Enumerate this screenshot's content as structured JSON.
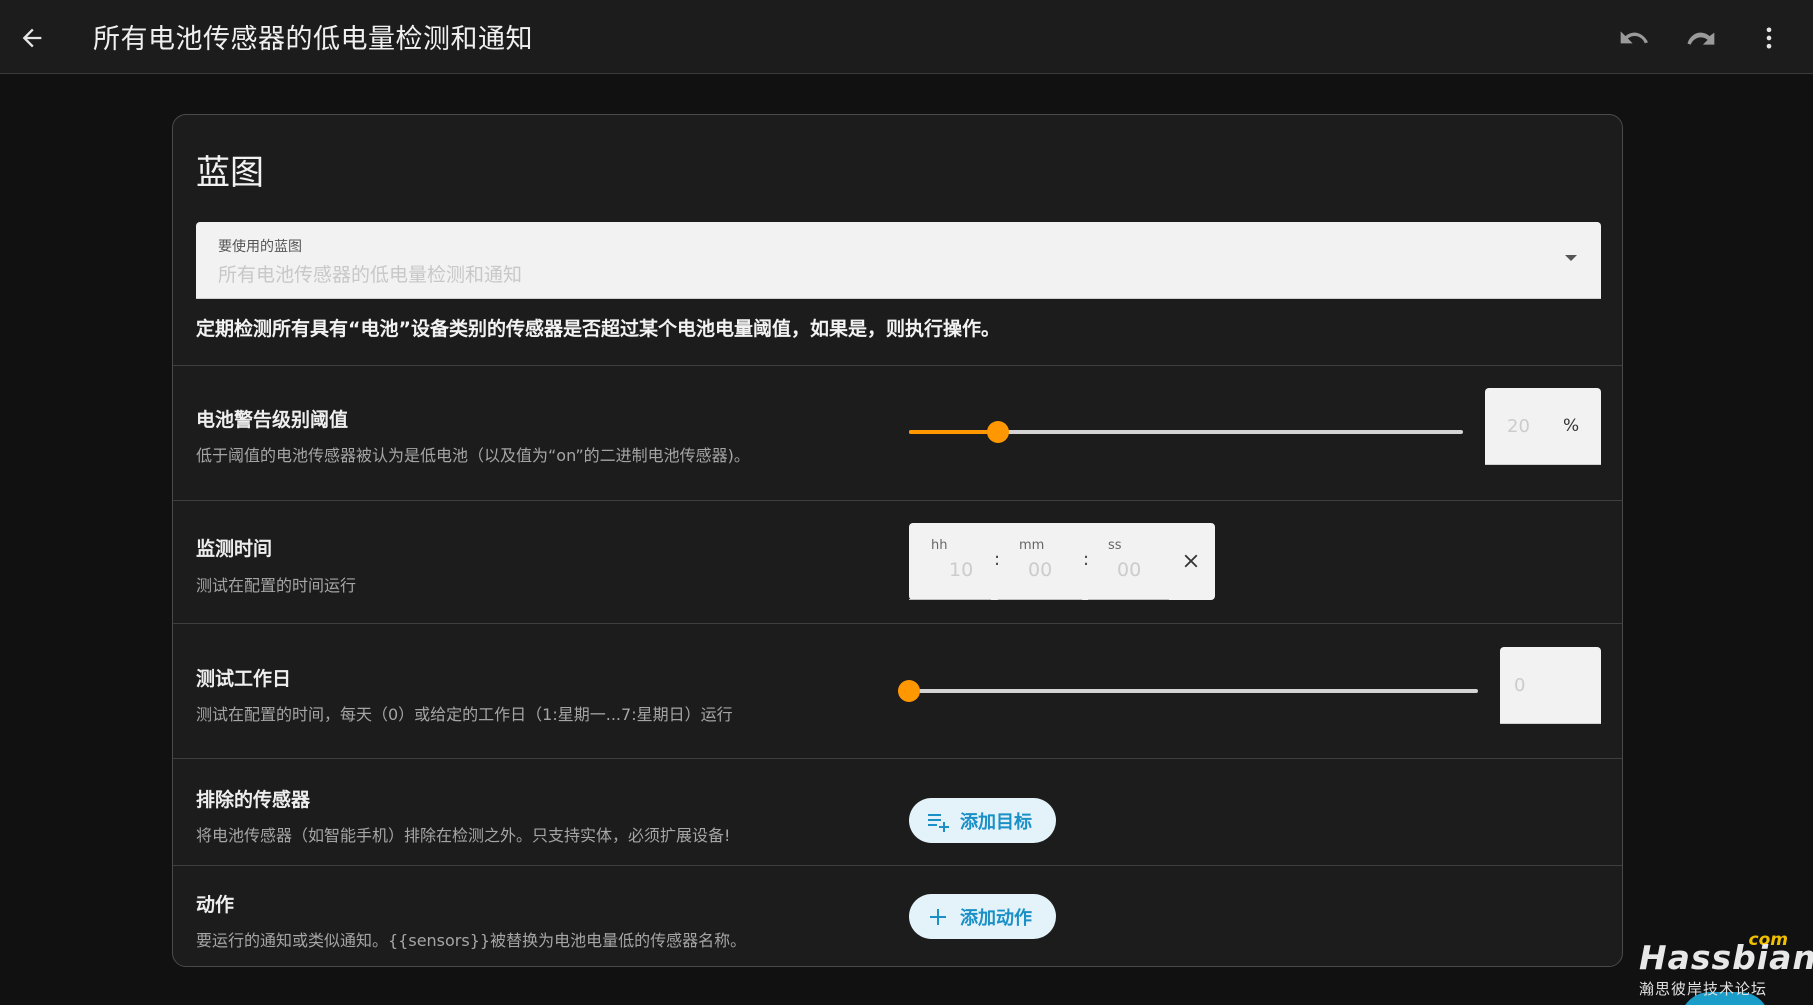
{
  "topbar": {
    "title": "所有电池传感器的低电量检测和通知",
    "icons": [
      "arrow-left-icon",
      "undo-icon",
      "redo-icon",
      "more-vertical-icon"
    ]
  },
  "card": {
    "title": "蓝图",
    "blueprint_select": {
      "label": "要使用的蓝图",
      "value": "所有电池传感器的低电量检测和通知"
    },
    "description": "定期检测所有具有“电池”设备类别的传感器是否超过某个电池电量阈值，如果是，则执行操作。"
  },
  "threshold": {
    "title": "电池警告级别阈值",
    "subtitle": "低于阈值的电池传感器被认为是低电池（以及值为“on”的二进制电池传感器)。",
    "value": "20",
    "unit": "%",
    "slider_fraction": 0.16
  },
  "time": {
    "title": "监测时间",
    "subtitle": "测试在配置的时间运行",
    "hh_label": "hh",
    "hh_value": "10",
    "mm_label": "mm",
    "mm_value": "00",
    "ss_label": "ss",
    "ss_value": "00",
    "sep": ":"
  },
  "weekday": {
    "title": "测试工作日",
    "subtitle": "测试在配置的时间，每天（0）或给定的工作日（1:星期一...7:星期日）运行",
    "value": "0",
    "slider_fraction": 0.0
  },
  "exclude": {
    "title": "排除的传感器",
    "subtitle": "将电池传感器（如智能手机）排除在检测之外。只支持实体，必须扩展设备!",
    "button": "添加目标"
  },
  "actions": {
    "title": "动作",
    "subtitle": "要运行的通知或类似通知。{{sensors}}被替换为电池电量低的传感器名称。",
    "button": "添加动作"
  },
  "watermark": {
    "com": "com",
    "brand": "Hassbian",
    "sub": "瀚思彼岸技术论坛"
  },
  "colors": {
    "accent": "#ff9800",
    "button_text": "#1a90c6",
    "button_bg": "#e4f3fa"
  }
}
